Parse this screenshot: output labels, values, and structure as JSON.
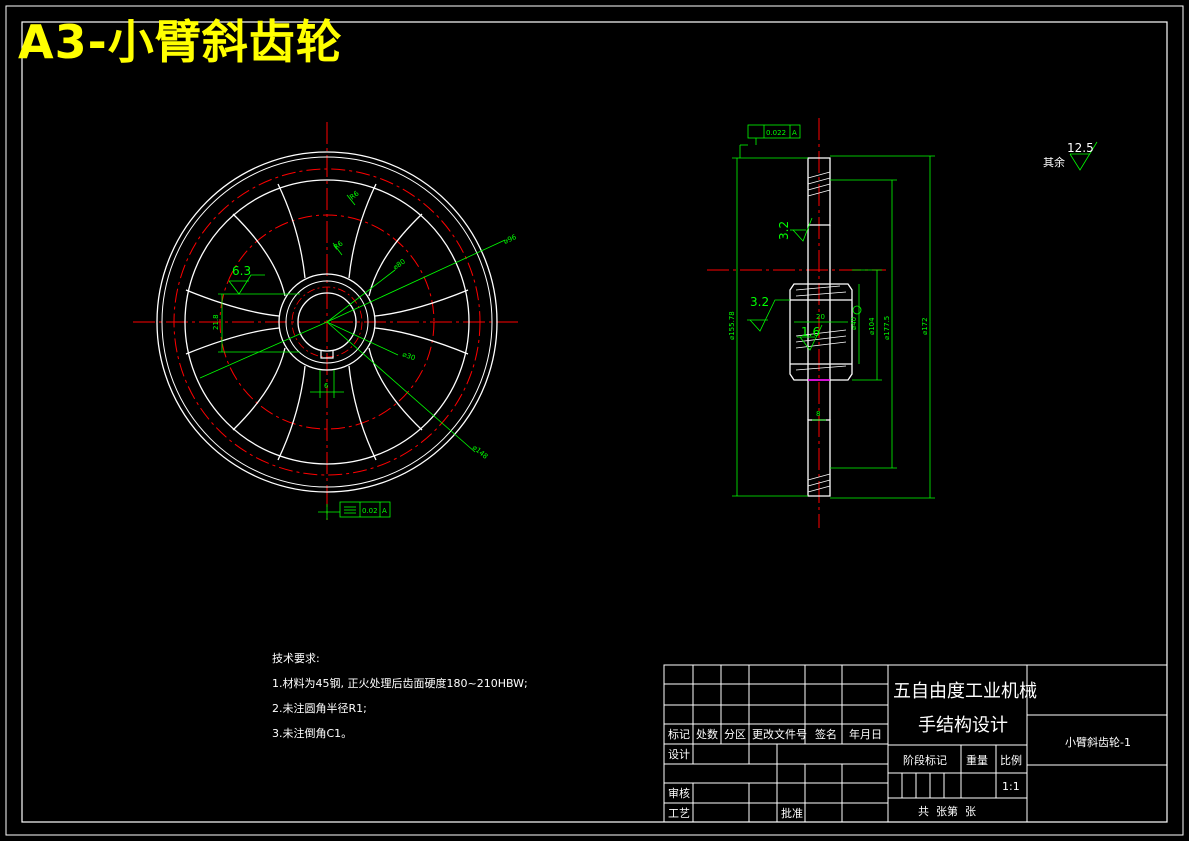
{
  "page_title": "A3-小臂斜齿轮",
  "drawing": {
    "left_view": {
      "dims": {
        "r6": "R6",
        "r6b": "R6",
        "phi96": "⌀96",
        "phi80": "⌀80",
        "phi30": "⌀30",
        "phi148": "⌀148",
        "d218": "21.8",
        "d6": "6"
      },
      "roughness": "6.3",
      "tolerance": {
        "value": "0.02",
        "datum": "A"
      }
    },
    "right_view": {
      "tolerance": {
        "value": "0.022",
        "datum": "A"
      },
      "roughness": [
        "3.2",
        "3.2",
        "1.6"
      ],
      "dims": {
        "phi15578": "⌀155.78",
        "phi1875": "⌀177.5",
        "phi172": "⌀172",
        "phi104": "⌀104",
        "phi40": "⌀40",
        "d20": "20",
        "d8": "8"
      }
    },
    "general_roughness": {
      "label": "其余",
      "value": "12.5"
    }
  },
  "tech_requirements": {
    "heading": "技术要求:",
    "items": [
      "1.材料为45钢, 正火处理后齿面硬度180~210HBW;",
      "2.未注圆角半径R1;",
      "3.未注倒角C1。"
    ]
  },
  "title_block": {
    "project_line1": "五自由度工业机械",
    "project_line2": "手结构设计",
    "part_name": "小臂斜齿轮-1",
    "headers": [
      "标记",
      "处数",
      "分区",
      "更改文件号",
      "签名",
      "年月日"
    ],
    "roles": {
      "design": "设计",
      "review": "审核",
      "process": "工艺",
      "approve": "批准"
    },
    "stage_mark": "阶段标记",
    "weight": "重量",
    "ratio_label": "比例",
    "ratio_value": "1:1",
    "sheets": "共  张第  张"
  },
  "colors": {
    "outline": "#ffffff",
    "centerline": "#ff0000",
    "dimension": "#00ff00",
    "title": "#ffff00",
    "accent": "#ff00ff"
  }
}
